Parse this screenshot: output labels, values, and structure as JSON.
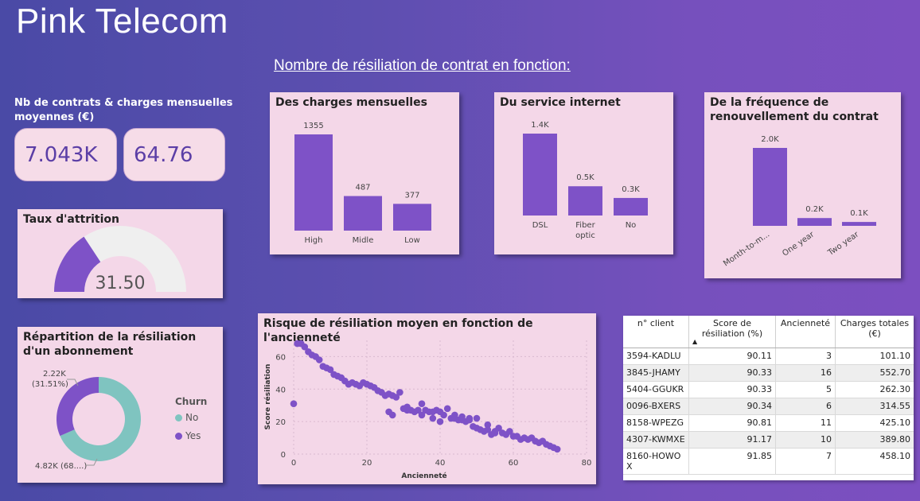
{
  "app_title": "Pink Telecom",
  "headline": "Nombre de résiliation de contrat en fonction:",
  "kpi": {
    "title": "Nb de contrats & charges mensuelles moyennes (€)",
    "contracts": "7.043K",
    "avg_charge": "64.76"
  },
  "attrition": {
    "title": "Taux d'attrition",
    "value": "31.50",
    "fraction": 0.315
  },
  "donut": {
    "title": "Répartition de la résiliation d'un abonnement",
    "yes_label_line1": "2.22K",
    "yes_label_line2": "(31.51%)",
    "no_label": "4.82K (68....)",
    "legend_title": "Churn",
    "legend_no": "No",
    "legend_yes": "Yes",
    "colors": {
      "no": "#7fc4c0",
      "yes": "#7e52c7"
    }
  },
  "colors": {
    "bar": "#7e52c7",
    "accent": "#5b3ea6"
  },
  "chart_data": [
    {
      "type": "bar",
      "title": "Des charges mensuelles",
      "categories": [
        "High",
        "Midle",
        "Low"
      ],
      "values": [
        1355,
        487,
        377
      ],
      "data_labels": [
        "1355",
        "487",
        "377"
      ]
    },
    {
      "type": "bar",
      "title": "Du service internet",
      "categories": [
        "DSL",
        "Fiber optic",
        "No"
      ],
      "values": [
        1400,
        500,
        300
      ],
      "data_labels": [
        "1.4K",
        "0.5K",
        "0.3K"
      ]
    },
    {
      "type": "bar",
      "title": "De la fréquence de renouvellement du contrat",
      "categories": [
        "Month-to-m...",
        "One year",
        "Two year"
      ],
      "values": [
        2000,
        200,
        100
      ],
      "data_labels": [
        "2.0K",
        "0.2K",
        "0.1K"
      ]
    },
    {
      "type": "pie",
      "title": "Répartition de la résiliation d'un abonnement",
      "categories": [
        "No",
        "Yes"
      ],
      "values": [
        4820,
        2220
      ]
    },
    {
      "type": "scatter",
      "title": "Risque de résiliation moyen en fonction de l'ancienneté",
      "xlabel": "Ancienneté",
      "ylabel": "Score résiliation",
      "xlim": [
        0,
        80
      ],
      "ylim": [
        0,
        70
      ],
      "xticks": [
        "0",
        "20",
        "40",
        "60",
        "80"
      ],
      "yticks": [
        "0",
        "20",
        "40",
        "60"
      ],
      "points": [
        [
          0,
          31
        ],
        [
          1,
          68
        ],
        [
          2,
          68
        ],
        [
          3,
          66
        ],
        [
          4,
          63
        ],
        [
          5,
          61
        ],
        [
          6,
          60
        ],
        [
          7,
          58
        ],
        [
          8,
          54
        ],
        [
          9,
          53
        ],
        [
          10,
          52
        ],
        [
          11,
          49
        ],
        [
          12,
          48
        ],
        [
          13,
          47
        ],
        [
          14,
          45
        ],
        [
          15,
          43
        ],
        [
          16,
          44
        ],
        [
          17,
          43
        ],
        [
          18,
          42
        ],
        [
          19,
          44
        ],
        [
          20,
          43
        ],
        [
          21,
          42
        ],
        [
          22,
          41
        ],
        [
          23,
          39
        ],
        [
          24,
          38
        ],
        [
          25,
          36
        ],
        [
          26,
          37
        ],
        [
          27,
          36
        ],
        [
          28,
          35
        ],
        [
          29,
          38
        ],
        [
          30,
          28
        ],
        [
          31,
          29
        ],
        [
          32,
          27
        ],
        [
          33,
          26
        ],
        [
          34,
          27
        ],
        [
          35,
          24
        ],
        [
          36,
          27
        ],
        [
          37,
          26
        ],
        [
          38,
          26
        ],
        [
          39,
          27
        ],
        [
          40,
          26
        ],
        [
          41,
          24
        ],
        [
          42,
          28
        ],
        [
          43,
          22
        ],
        [
          44,
          24
        ],
        [
          45,
          21
        ],
        [
          46,
          23
        ],
        [
          47,
          20
        ],
        [
          48,
          21
        ],
        [
          49,
          17
        ],
        [
          50,
          22
        ],
        [
          51,
          15
        ],
        [
          52,
          14
        ],
        [
          53,
          15
        ],
        [
          54,
          12
        ],
        [
          55,
          14
        ],
        [
          56,
          16
        ],
        [
          57,
          13
        ],
        [
          58,
          12
        ],
        [
          59,
          14
        ],
        [
          60,
          11
        ],
        [
          61,
          11
        ],
        [
          62,
          9
        ],
        [
          63,
          10
        ],
        [
          64,
          9
        ],
        [
          65,
          10
        ],
        [
          66,
          8
        ],
        [
          67,
          7
        ],
        [
          68,
          8
        ],
        [
          69,
          6
        ],
        [
          70,
          5
        ],
        [
          71,
          4
        ],
        [
          72,
          3
        ],
        [
          40,
          20
        ],
        [
          44,
          22
        ],
        [
          46,
          21
        ],
        [
          48,
          22
        ],
        [
          50,
          16
        ],
        [
          53,
          18
        ],
        [
          55,
          13
        ],
        [
          26,
          26
        ],
        [
          27,
          24
        ],
        [
          31,
          27
        ],
        [
          35,
          31
        ],
        [
          38,
          22
        ]
      ]
    }
  ],
  "table": {
    "headers": [
      "n° client",
      "Score de résiliation (%)",
      "Ancienneté",
      "Charges totales (€)"
    ],
    "rows": [
      [
        "3594-KADLU",
        "90.11",
        "3",
        "101.10"
      ],
      [
        "3845-JHAMY",
        "90.33",
        "16",
        "552.70"
      ],
      [
        "5404-GGUKR",
        "90.33",
        "5",
        "262.30"
      ],
      [
        "0096-BXERS",
        "90.34",
        "6",
        "314.55"
      ],
      [
        "8158-WPEZG",
        "90.81",
        "11",
        "425.10"
      ],
      [
        "4307-KWMXE",
        "91.17",
        "10",
        "389.80"
      ],
      [
        "8160-HOWOX",
        "91.85",
        "7",
        "458.10"
      ]
    ]
  }
}
